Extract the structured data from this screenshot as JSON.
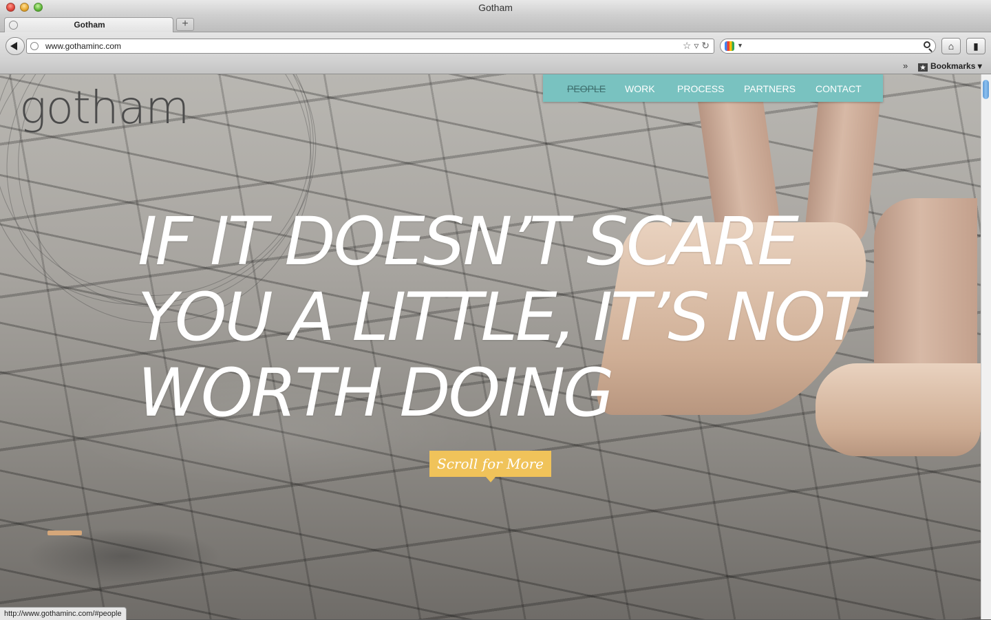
{
  "window": {
    "title": "Gotham"
  },
  "tabs": [
    {
      "label": "Gotham"
    }
  ],
  "new_tab_label": "+",
  "toolbar": {
    "url": "www.gothaminc.com",
    "url_icons": "☆ ▿ ↻",
    "home_icon": "⌂",
    "bookmarks_icon": "▮"
  },
  "bookmarks_bar": {
    "chevron": "»",
    "item_icon": "★",
    "item_label": "Bookmarks ▾"
  },
  "page": {
    "logo": "gotham",
    "nav": [
      {
        "label": "PEOPLE",
        "active": true
      },
      {
        "label": "WORK",
        "active": false
      },
      {
        "label": "PROCESS",
        "active": false
      },
      {
        "label": "PARTNERS",
        "active": false
      },
      {
        "label": "CONTACT",
        "active": false
      }
    ],
    "headline": [
      "IF IT DOESN’T SCARE",
      "YOU A LITTLE, IT’S NOT",
      "WORTH DOING"
    ],
    "scroll_button": "Scroll for More",
    "accent_color": "#79c2c0",
    "button_color": "#f0c35a"
  },
  "status_bar": {
    "text": "http://www.gothaminc.com/#people"
  }
}
